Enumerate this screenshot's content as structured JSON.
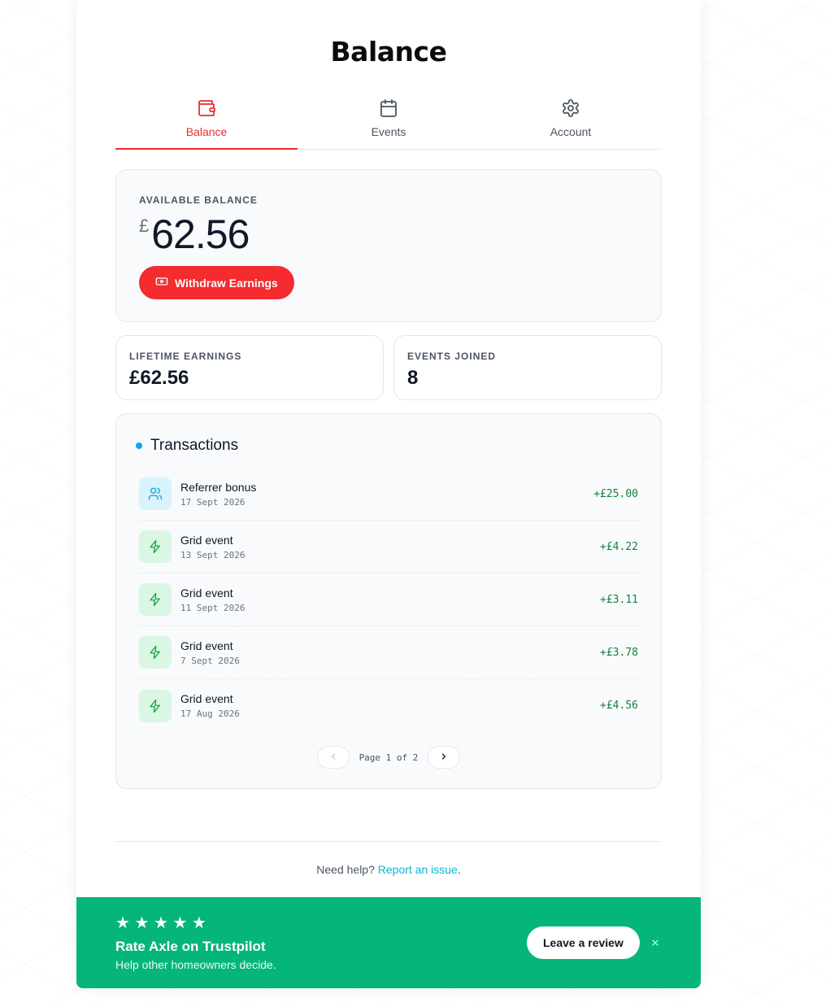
{
  "page": {
    "title": "Balance"
  },
  "tabs": [
    {
      "label": "Balance",
      "icon": "wallet-icon",
      "active": true
    },
    {
      "label": "Events",
      "icon": "calendar-icon",
      "active": false
    },
    {
      "label": "Account",
      "icon": "gear-icon",
      "active": false
    }
  ],
  "balance": {
    "label": "AVAILABLE BALANCE",
    "currency": "£",
    "amount": "62.56",
    "withdraw_label": "Withdraw Earnings"
  },
  "stats": {
    "lifetime": {
      "label": "LIFETIME EARNINGS",
      "value": "£62.56"
    },
    "events": {
      "label": "EVENTS JOINED",
      "value": "8"
    }
  },
  "transactions": {
    "title": "Transactions",
    "items": [
      {
        "name": "Referrer bonus",
        "date": "17 Sept 2026",
        "amount": "+£25.00",
        "icon": "users-icon"
      },
      {
        "name": "Grid event",
        "date": "13 Sept 2026",
        "amount": "+£4.22",
        "icon": "lightning-icon"
      },
      {
        "name": "Grid event",
        "date": "11 Sept 2026",
        "amount": "+£3.11",
        "icon": "lightning-icon"
      },
      {
        "name": "Grid event",
        "date": "7 Sept 2026",
        "amount": "+£3.78",
        "icon": "lightning-icon"
      },
      {
        "name": "Grid event",
        "date": "17 Aug 2026",
        "amount": "+£4.56",
        "icon": "lightning-icon"
      }
    ],
    "pagination": {
      "text": "Page 1 of 2"
    }
  },
  "help": {
    "prefix": "Need help?",
    "link": "Report an issue",
    "suffix": "."
  },
  "trustpilot": {
    "stars": "★ ★ ★ ★ ★",
    "title": "Rate Axle on Trustpilot",
    "subtitle": "Help other homeowners decide.",
    "button_label": "Leave a review"
  },
  "colors": {
    "accent": "#ef2b2d",
    "success": "#06b57a",
    "link": "#0ab5cf"
  }
}
